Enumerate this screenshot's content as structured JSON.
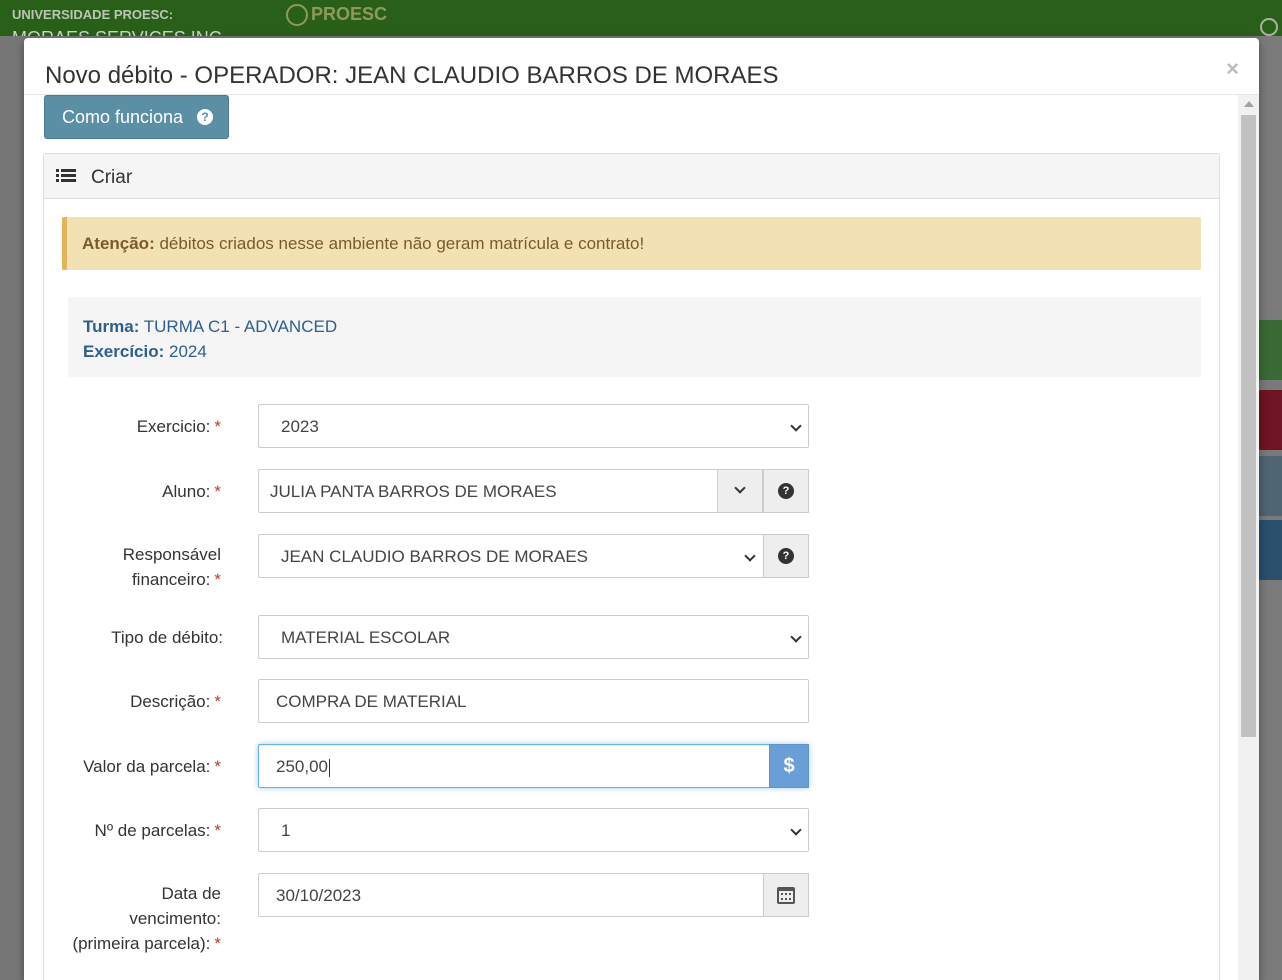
{
  "app": {
    "brand_line1": "UNIVERSIDADE PROESC:",
    "brand_line2": "MORAES SERVICES INC",
    "logo_text": "PROESC"
  },
  "modal": {
    "title": "Novo débito - OPERADOR: JEAN CLAUDIO BARROS DE MORAES",
    "close_label": "×",
    "how_it_works_label": "Como funciona",
    "panel_title": "Criar",
    "alert_strong": "Atenção:",
    "alert_text": " débitos criados nesse ambiente não geram matrícula e contrato!",
    "info": {
      "turma_label": "Turma:",
      "turma_value": " TURMA C1 - ADVANCED",
      "exercicio_label": "Exercício:",
      "exercicio_value": " 2024"
    },
    "form": {
      "exercicio_label": "Exercicio:",
      "exercicio_value": "2023",
      "aluno_label": "Aluno:",
      "aluno_value": "JULIA PANTA BARROS DE MORAES",
      "responsavel_label_1": "Responsável",
      "responsavel_label_2": "financeiro:",
      "responsavel_value": "JEAN CLAUDIO BARROS DE MORAES",
      "tipo_label": "Tipo de débito:",
      "tipo_value": "MATERIAL ESCOLAR",
      "descricao_label": "Descrição:",
      "descricao_value": "COMPRA DE MATERIAL",
      "valor_label": "Valor da parcela:",
      "valor_value": "250,00",
      "valor_addon": "$",
      "parcelas_label": "Nº de parcelas:",
      "parcelas_value": "1",
      "vencimento_label_1": "Data de",
      "vencimento_label_2": "vencimento:",
      "vencimento_label_3": "(primeira parcela):",
      "vencimento_value": "30/10/2023",
      "required_mark": "*"
    }
  },
  "colors": {
    "topbar": "#2a5f1a",
    "button_info": "#5b8fa4",
    "alert_bg": "#f2e2b3",
    "alert_border": "#e4b35a",
    "info_text": "#2c5f8f",
    "required": "#c0392b",
    "addon_blue": "#6a9ed6"
  },
  "icons": [
    "help-icon",
    "list-icon",
    "chevron-down-icon",
    "dollar-icon",
    "calendar-icon",
    "close-icon"
  ]
}
